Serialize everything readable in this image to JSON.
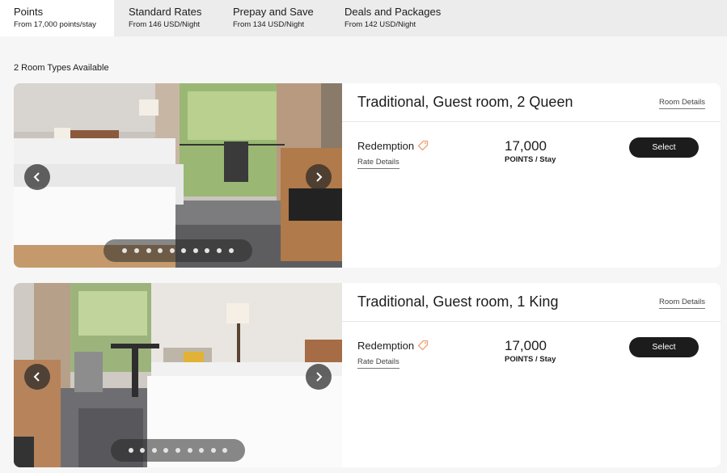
{
  "tabs": [
    {
      "title": "Points",
      "subtitle": "From 17,000 points/stay",
      "active": true
    },
    {
      "title": "Standard Rates",
      "subtitle": "From 146 USD/Night",
      "active": false
    },
    {
      "title": "Prepay and Save",
      "subtitle": "From 134 USD/Night",
      "active": false
    },
    {
      "title": "Deals and Packages",
      "subtitle": "From 142 USD/Night",
      "active": false
    }
  ],
  "availability": "2 Room Types Available",
  "rooms": [
    {
      "title": "Traditional, Guest room, 2 Queen",
      "details_link": "Room Details",
      "rate_name": "Redemption",
      "rate_details_link": "Rate Details",
      "price": "17,000",
      "price_unit": "POINTS / Stay",
      "select_label": "Select",
      "photo_count": 10
    },
    {
      "title": "Traditional, Guest room, 1 King",
      "details_link": "Room Details",
      "rate_name": "Redemption",
      "rate_details_link": "Rate Details",
      "price": "17,000",
      "price_unit": "POINTS / Stay",
      "select_label": "Select",
      "photo_count": 9
    }
  ],
  "icons": {
    "tag": "tag-icon",
    "prev": "chevron-left-icon",
    "next": "chevron-right-icon"
  },
  "colors": {
    "accent_tag": "#f0a070",
    "button": "#1c1c1c",
    "tab_bar": "#ececec"
  }
}
